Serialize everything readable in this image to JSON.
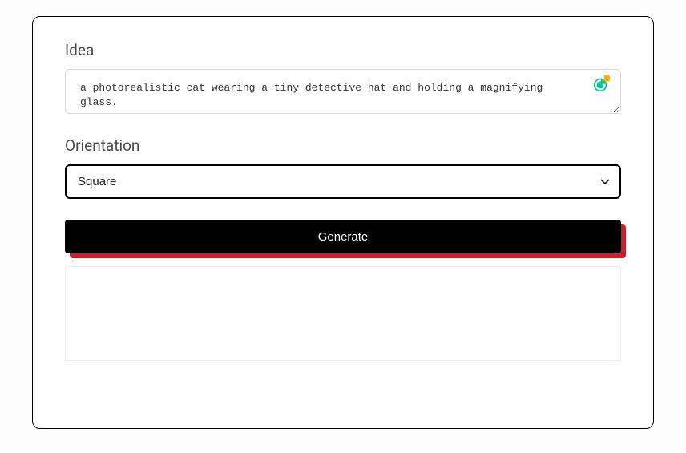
{
  "form": {
    "idea_label": "Idea",
    "idea_value": "a photorealistic cat wearing a tiny detective hat and holding a magnifying glass.",
    "orientation_label": "Orientation",
    "orientation_value": "Square",
    "generate_label": "Generate"
  },
  "grammarly": {
    "badge_count": "1"
  }
}
